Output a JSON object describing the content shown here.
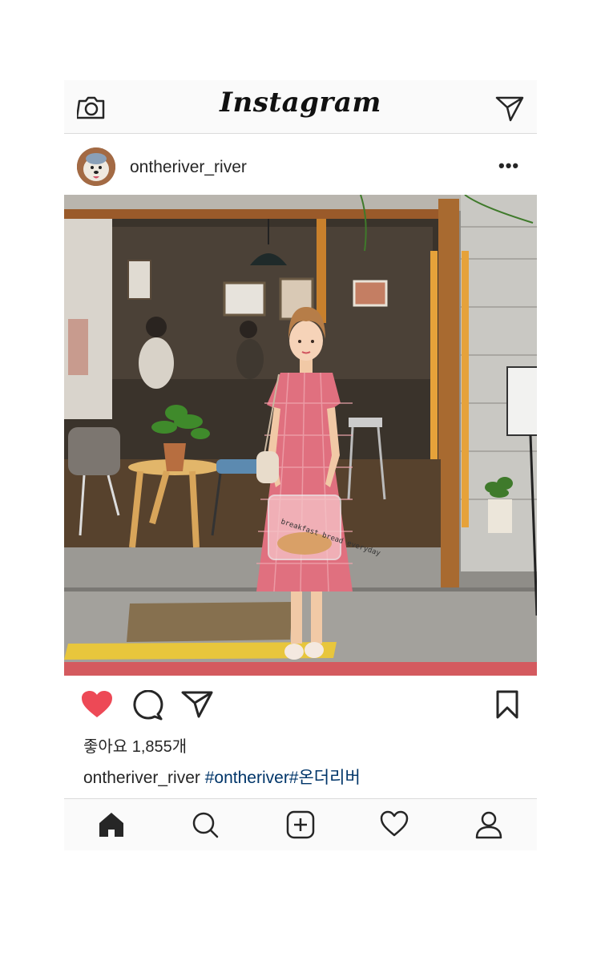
{
  "app": {
    "title": "Instagram"
  },
  "post": {
    "username": "ontheriver_river",
    "more_label": "•••",
    "likes_text": "좋아요 1,855개",
    "caption_user": "ontheriver_river",
    "caption_hashtags": "#ontheriver#온더리버",
    "liked": true,
    "photo_bag_text": "breakfast bread everyday"
  },
  "icons": {
    "camera": "camera-icon",
    "direct": "paper-plane-icon",
    "like": "heart-filled-icon",
    "comment": "speech-bubble-icon",
    "share": "paper-plane-icon",
    "save": "bookmark-icon",
    "home": "home-icon",
    "search": "search-icon",
    "add": "plus-square-icon",
    "activity": "heart-outline-icon",
    "profile": "person-icon"
  },
  "colors": {
    "like_red": "#ed4956",
    "hashtag_blue": "#003569",
    "text": "#262626",
    "bar_bg": "#fafafa",
    "divider": "#dbdbdb"
  }
}
